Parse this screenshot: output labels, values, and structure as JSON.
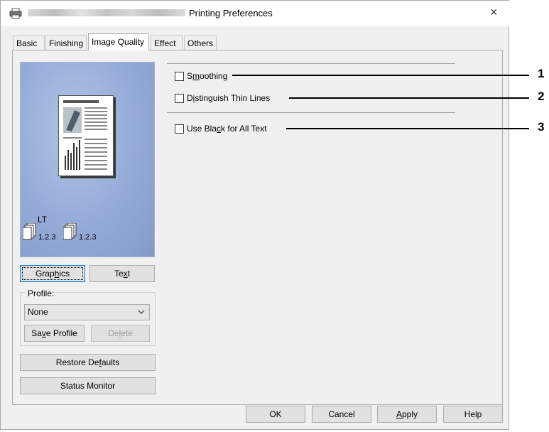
{
  "window": {
    "title": "Printing Preferences",
    "close_glyph": "×",
    "icon": "printer-icon"
  },
  "tabs": [
    {
      "label": "Basic"
    },
    {
      "label": "Finishing"
    },
    {
      "label": "Image Quality",
      "active": true
    },
    {
      "label": "Effect"
    },
    {
      "label": "Others"
    }
  ],
  "preview": {
    "paper_size": "LT",
    "copies_label_1": "1.2.3",
    "copies_label_2": "1.2.3"
  },
  "options": {
    "smoothing": {
      "pre": "S",
      "ul": "m",
      "post": "oothing",
      "checked": false
    },
    "distinguish_thin_lines": {
      "pre": "D",
      "ul": "i",
      "post": "stinguish Thin Lines",
      "checked": false
    },
    "use_black_for_all_text": {
      "pre": "Use Bla",
      "ul": "c",
      "post": "k for All Text",
      "checked": false
    }
  },
  "callouts": [
    "1",
    "2",
    "3"
  ],
  "mode_buttons": {
    "graphics": {
      "pre": "Grap",
      "ul": "h",
      "post": "ics"
    },
    "text": {
      "pre": "Te",
      "ul": "x",
      "post": "t"
    }
  },
  "profile": {
    "label": "Profile:",
    "selected": "None",
    "save": {
      "pre": "Sa",
      "ul": "v",
      "post": "e Profile"
    },
    "delete": {
      "pre": "De",
      "ul": "l",
      "post": "ete"
    }
  },
  "restore_defaults": {
    "pre": "Restore De",
    "ul": "f",
    "post": "aults"
  },
  "status_monitor": "Status Monitor",
  "footer": {
    "ok": "OK",
    "cancel": "Cancel",
    "apply": {
      "pre": "",
      "ul": "A",
      "post": "pply"
    },
    "help": "Help"
  }
}
